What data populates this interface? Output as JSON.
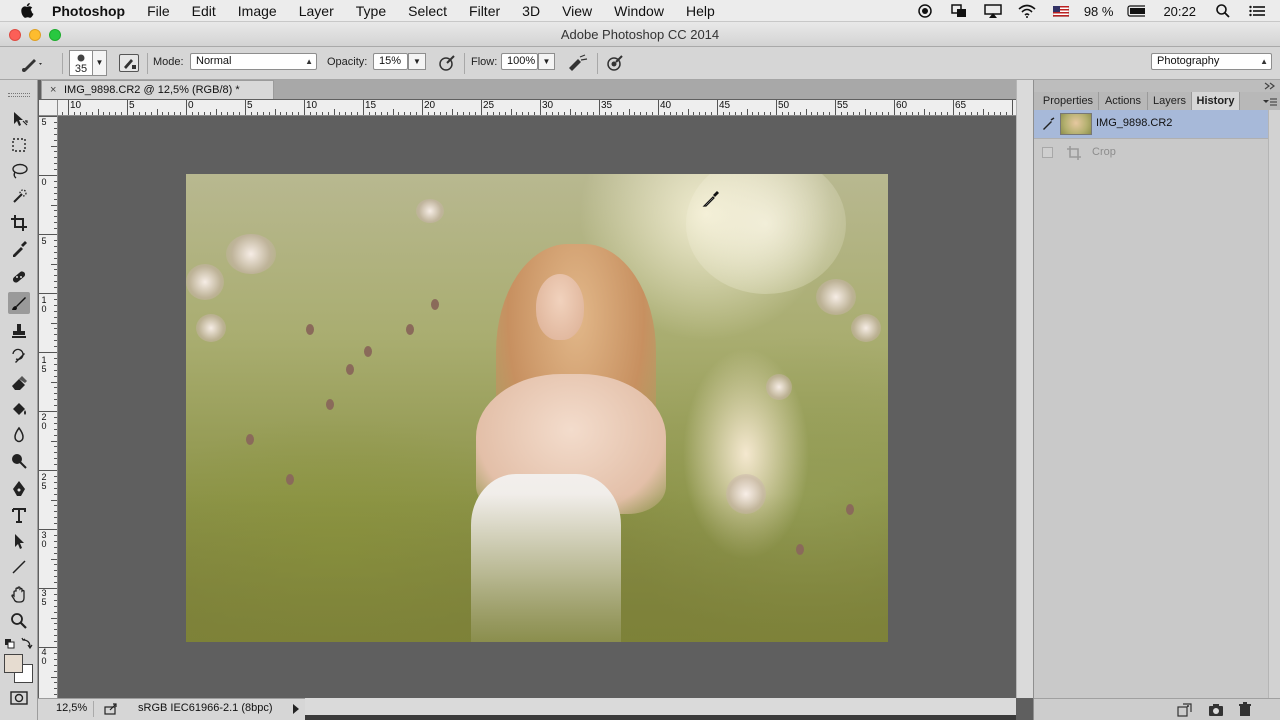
{
  "menubar": {
    "app_name": "Photoshop",
    "menus": [
      "File",
      "Edit",
      "Image",
      "Layer",
      "Type",
      "Select",
      "Filter",
      "3D",
      "View",
      "Window",
      "Help"
    ],
    "battery": "98 %",
    "time": "20:22"
  },
  "window": {
    "title": "Adobe Photoshop CC 2014"
  },
  "options": {
    "brush_size": "35",
    "mode_label": "Mode:",
    "mode_value": "Normal",
    "opacity_label": "Opacity:",
    "opacity_value": "15%",
    "flow_label": "Flow:",
    "flow_value": "100%",
    "workspace": "Photography"
  },
  "document": {
    "tab_title": "IMG_9898.CR2 @ 12,5% (RGB/8) *",
    "close_glyph": "×"
  },
  "rulers": {
    "horizontal": [
      "10",
      "5",
      "0",
      "5",
      "10",
      "15",
      "20",
      "25",
      "30",
      "35",
      "40",
      "45",
      "50",
      "55",
      "60",
      "65"
    ],
    "vertical": [
      "5",
      "0",
      "5",
      "10",
      "15",
      "20",
      "25",
      "30",
      "35",
      "40"
    ]
  },
  "status": {
    "zoom": "12,5%",
    "doc_profile": "sRGB IEC61966-2.1 (8bpc)"
  },
  "panel": {
    "tabs": [
      "Properties",
      "Actions",
      "Layers",
      "History"
    ],
    "active_tab": "History",
    "history_snapshot": "IMG_9898.CR2",
    "history_step": "Crop"
  },
  "colors": {
    "selection": "#a7b9d9",
    "foreground_swatch": "#e6dcd0",
    "background_swatch": "#ffffff"
  },
  "icons": {
    "tools": [
      "move-icon",
      "marquee-icon",
      "lasso-icon",
      "quick-select-icon",
      "crop-icon",
      "eyedropper-icon",
      "healing-brush-icon",
      "brush-icon",
      "clone-stamp-icon",
      "history-brush-icon",
      "eraser-icon",
      "paint-bucket-icon",
      "blur-icon",
      "dodge-icon",
      "pen-icon",
      "type-icon",
      "path-select-icon",
      "line-icon",
      "hand-icon",
      "zoom-icon"
    ],
    "tray": [
      "record-icon",
      "screens-icon",
      "airplay-icon",
      "wifi-icon",
      "flag-icon",
      "battery-icon",
      "search-icon",
      "list-icon"
    ]
  }
}
